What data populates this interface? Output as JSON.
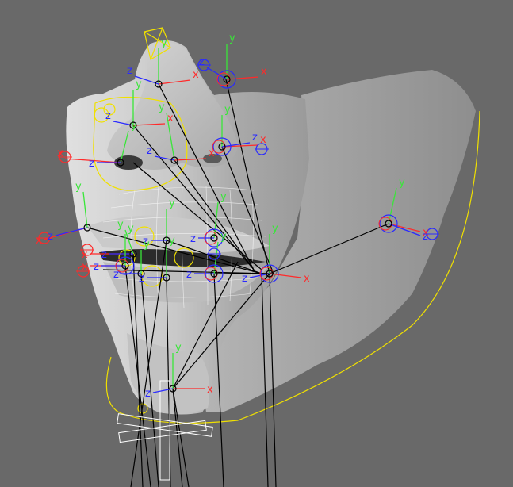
{
  "viewport": {
    "background": "#696969",
    "mesh_color": "#cfcfcf",
    "wire_color": "#000000",
    "selection_color": "#f0e000"
  },
  "axis_labels": {
    "x": "x",
    "y": "y",
    "z": "z"
  },
  "axis_colors": {
    "x": "#ff2a2a",
    "y": "#39e639",
    "z": "#2a2aff"
  },
  "icons": [
    "joint-icon",
    "locator-icon",
    "controller-circle-icon",
    "pyramid-handle-icon",
    "cross-control-icon"
  ]
}
